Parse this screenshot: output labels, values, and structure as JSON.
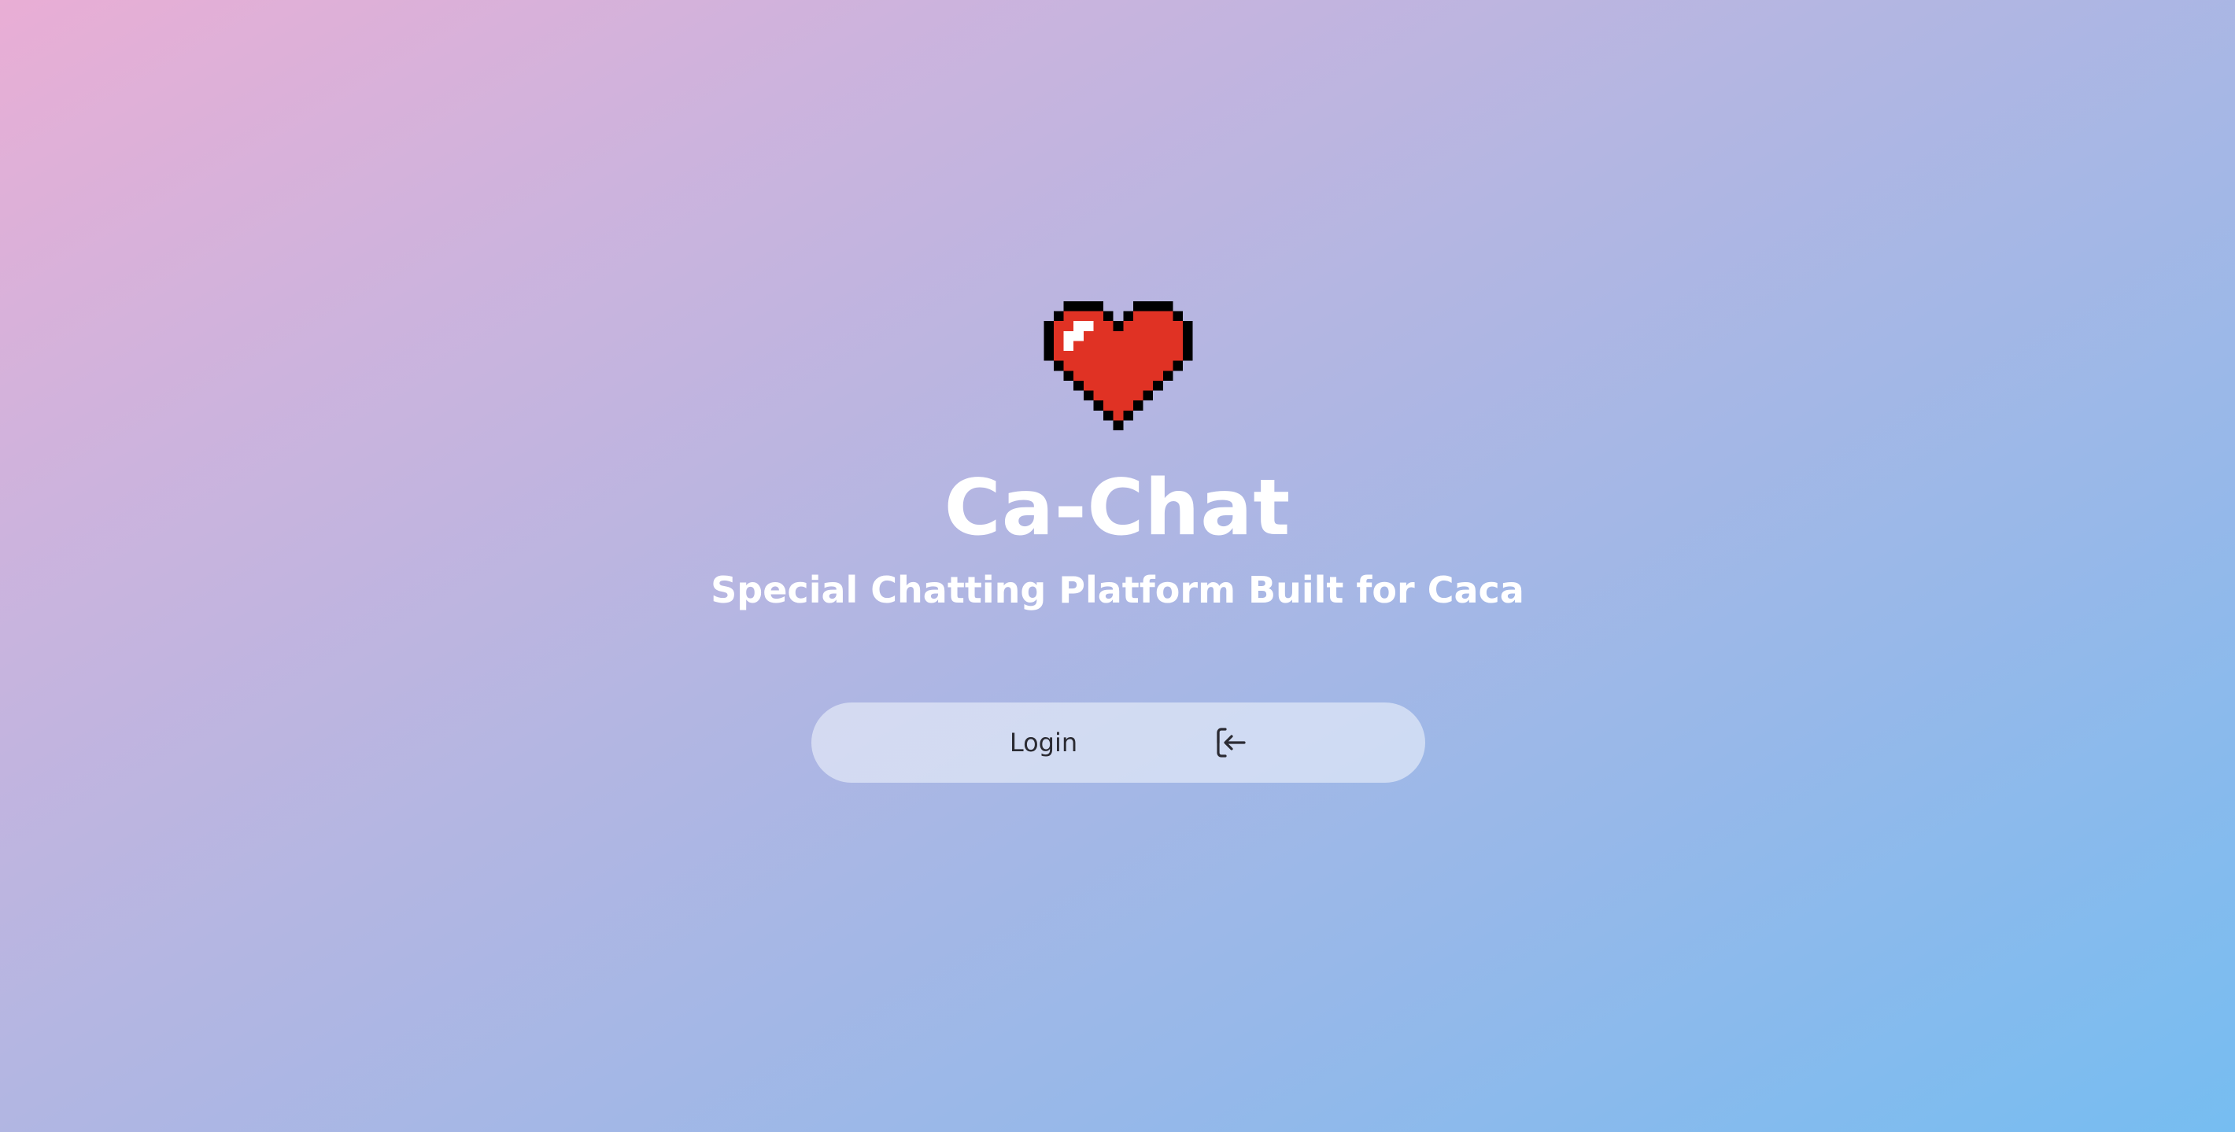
{
  "app": {
    "title": "Ca-Chat",
    "subtitle": "Special Chatting Platform Built for Caca"
  },
  "logo": {
    "icon": "pixel-heart-icon",
    "colors": {
      "fill": "#e03224",
      "outline": "#000000",
      "highlight": "#ffffff"
    }
  },
  "login": {
    "label": "Login",
    "icon": "login-icon"
  },
  "theme": {
    "gradient_start": "#e9aed5",
    "gradient_end": "#76bdf1",
    "text_color": "#ffffff",
    "button_text": "#2b2b33"
  }
}
